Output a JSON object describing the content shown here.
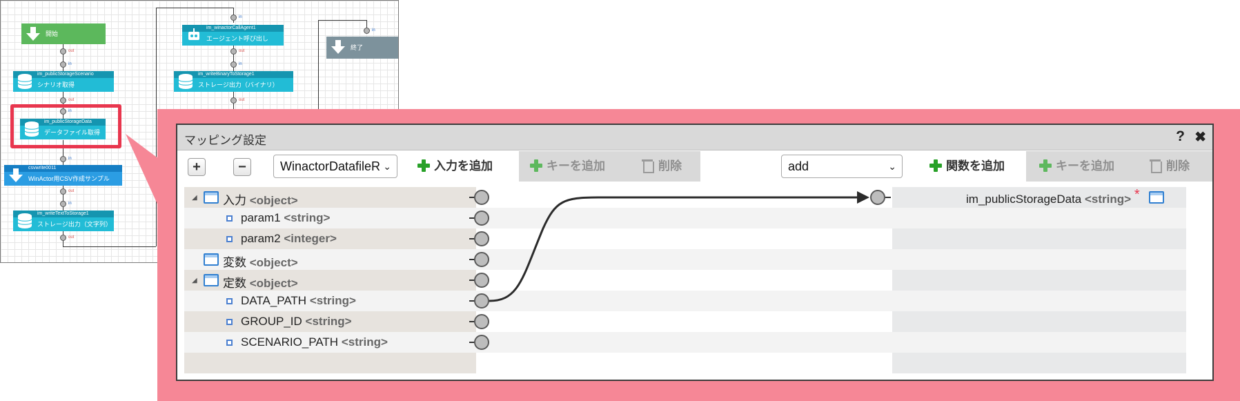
{
  "flow": {
    "nodes": [
      {
        "id": "start",
        "label": "開始"
      },
      {
        "id": "scenario",
        "sub": "im_publicStorageScenario",
        "label": "シナリオ取得"
      },
      {
        "id": "datafile",
        "sub": "im_publicStorageData",
        "label": "データファイル取得"
      },
      {
        "id": "csvwrite",
        "sub": "csvwrite0011",
        "label": "WinActor用CSV作成サンプル"
      },
      {
        "id": "writetext",
        "sub": "im_writeTextToStorage1",
        "label": "ストレージ出力（文字列）"
      },
      {
        "id": "agent",
        "sub": "im_winactorCallAgent1",
        "label": "エージェント呼び出し"
      },
      {
        "id": "writebinary",
        "sub": "im_writeBinaryToStorage1",
        "label": "ストレージ出力（バイナリ）"
      },
      {
        "id": "end",
        "label": "終了"
      }
    ],
    "port_in": "in",
    "port_out": "out"
  },
  "dialog": {
    "title": "マッピング設定",
    "help": "?",
    "close": "✖",
    "toolbar": {
      "expand": "+",
      "collapse": "−",
      "left_select": "WinactorDatafileR",
      "add_input": "入力を追加",
      "add_key_left": "キーを追加",
      "delete_left": "削除",
      "right_select": "add",
      "add_function": "関数を追加",
      "add_key_right": "キーを追加",
      "delete_right": "削除"
    },
    "left_tree": [
      {
        "name": "入力",
        "type": "<object>",
        "level": 0,
        "expandable": true
      },
      {
        "name": "param1",
        "type": "<string>",
        "level": 1
      },
      {
        "name": "param2",
        "type": "<integer>",
        "level": 1
      },
      {
        "name": "変数",
        "type": "<object>",
        "level": 0,
        "expandable": false
      },
      {
        "name": "定数",
        "type": "<object>",
        "level": 0,
        "expandable": true
      },
      {
        "name": "DATA_PATH",
        "type": "<string>",
        "level": 1
      },
      {
        "name": "GROUP_ID",
        "type": "<string>",
        "level": 1
      },
      {
        "name": "SCENARIO_PATH",
        "type": "<string>",
        "level": 1
      }
    ],
    "right_tree": [
      {
        "name": "im_publicStorageData",
        "type": "<string>",
        "required_mark": "*"
      }
    ],
    "mappings": [
      {
        "from": "DATA_PATH",
        "to": "im_publicStorageData"
      }
    ]
  },
  "colors": {
    "highlight": "#e8364e",
    "backdrop": "#f68796",
    "node_teal": "#22bcd6",
    "node_green": "#5cb85c",
    "node_grey": "#7d929c",
    "node_blue": "#2b9de3",
    "add_green": "#28a128"
  }
}
